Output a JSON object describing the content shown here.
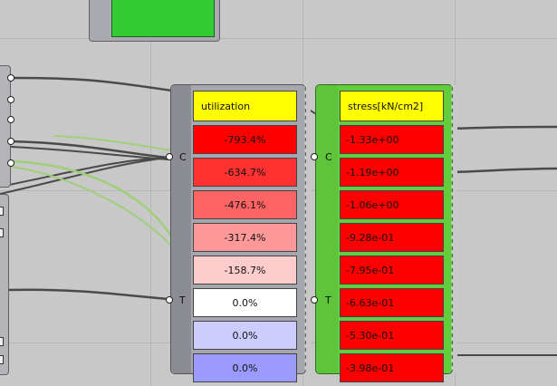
{
  "utilization_panel": {
    "header": "utilization",
    "inputs": [
      "C",
      "T"
    ],
    "values": [
      "-793.4%",
      "-634.7%",
      "-476.1%",
      "-317.4%",
      "-158.7%",
      "0.0%",
      "0.0%",
      "0.0%"
    ],
    "cell_colors": [
      "#ff0000",
      "#ff3131",
      "#ff6464",
      "#ff9898",
      "#ffcccc",
      "#ffffff",
      "#ccccff",
      "#9a9aff"
    ]
  },
  "stress_panel": {
    "header": "stress[kN/cm2]",
    "inputs": [
      "C",
      "T"
    ],
    "values": [
      "-1.33e+00",
      "-1.19e+00",
      "-1.06e+00",
      "-9.28e-01",
      "-7.95e-01",
      "-6.63e-01",
      "-5.30e-01",
      "-3.98e-01"
    ],
    "cell_color": "#ff0000"
  },
  "colors": {
    "header_yellow": "#ffff00",
    "swatch_green": "#33cc33",
    "wire_dark": "#4a4a4a",
    "wire_selected": "#9fcf7a"
  }
}
